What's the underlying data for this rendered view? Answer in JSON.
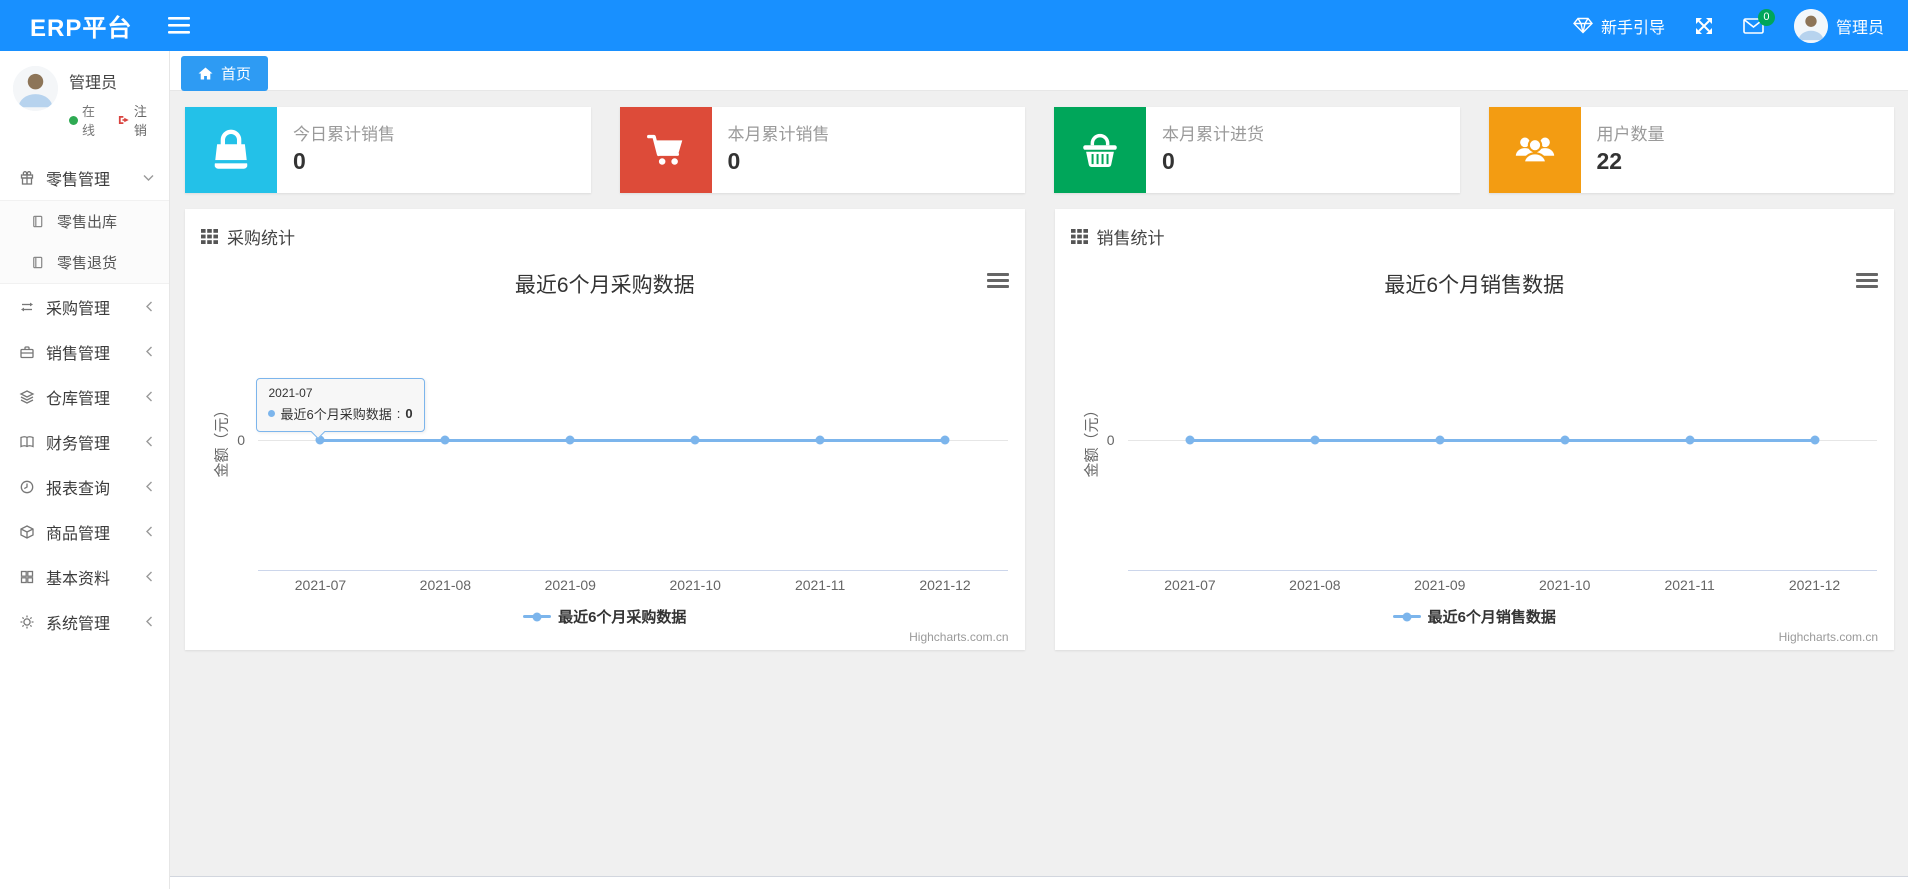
{
  "colors": {
    "navbar": "#1890ff",
    "tab_active": "#2e9bf3",
    "badge_green": "#00a65a",
    "series_blue": "#7cb5ec"
  },
  "navbar": {
    "logo": "ERP平台",
    "guide_label": "新手引导",
    "mail_badge": "0",
    "username": "管理员"
  },
  "sidebar": {
    "user": {
      "name": "管理员",
      "status": "在线",
      "logout_label": "注销"
    },
    "menu": [
      {
        "label": "零售管理",
        "icon": "gift-icon",
        "state": "expanded"
      },
      {
        "label": "采购管理",
        "icon": "exchange-icon",
        "state": "collapsed"
      },
      {
        "label": "销售管理",
        "icon": "briefcase-icon",
        "state": "collapsed"
      },
      {
        "label": "仓库管理",
        "icon": "layers-icon",
        "state": "collapsed"
      },
      {
        "label": "财务管理",
        "icon": "book-icon",
        "state": "collapsed"
      },
      {
        "label": "报表查询",
        "icon": "clock-icon",
        "state": "collapsed"
      },
      {
        "label": "商品管理",
        "icon": "cube-icon",
        "state": "collapsed"
      },
      {
        "label": "基本资料",
        "icon": "grid-icon",
        "state": "collapsed"
      },
      {
        "label": "系统管理",
        "icon": "gear-icon",
        "state": "collapsed"
      }
    ],
    "submenu": [
      {
        "label": "零售出库",
        "icon": "file-icon"
      },
      {
        "label": "零售退货",
        "icon": "file-icon"
      }
    ]
  },
  "tabs": {
    "home_label": "首页"
  },
  "stat_cards": [
    {
      "label": "今日累计销售",
      "value": "0",
      "color": "#23c1e8",
      "icon": "shopping-bag-icon"
    },
    {
      "label": "本月累计销售",
      "value": "0",
      "color": "#dd4b39",
      "icon": "cart-icon"
    },
    {
      "label": "本月累计进货",
      "value": "0",
      "color": "#00a65a",
      "icon": "basket-icon"
    },
    {
      "label": "用户数量",
      "value": "22",
      "color": "#f39c12",
      "icon": "users-icon"
    }
  ],
  "panels": [
    {
      "header": "采购统计"
    },
    {
      "header": "销售统计"
    }
  ],
  "chart_data": [
    {
      "type": "line",
      "title": "最近6个月采购数据",
      "categories": [
        "2021-07",
        "2021-08",
        "2021-09",
        "2021-10",
        "2021-11",
        "2021-12"
      ],
      "series": [
        {
          "name": "最近6个月采购数据",
          "values": [
            0,
            0,
            0,
            0,
            0,
            0
          ],
          "color": "#7cb5ec"
        }
      ],
      "xlabel": "",
      "ylabel": "金额（元）",
      "ytick": "0",
      "grid": true,
      "legend_position": "bottom",
      "watermark": "Highcharts.com.cn",
      "tooltip": {
        "title": "2021-07",
        "series": "最近6个月采购数据",
        "value": "0"
      }
    },
    {
      "type": "line",
      "title": "最近6个月销售数据",
      "categories": [
        "2021-07",
        "2021-08",
        "2021-09",
        "2021-10",
        "2021-11",
        "2021-12"
      ],
      "series": [
        {
          "name": "最近6个月销售数据",
          "values": [
            0,
            0,
            0,
            0,
            0,
            0
          ],
          "color": "#7cb5ec"
        }
      ],
      "xlabel": "",
      "ylabel": "金额（元）",
      "ytick": "0",
      "grid": true,
      "legend_position": "bottom",
      "watermark": "Highcharts.com.cn"
    }
  ]
}
